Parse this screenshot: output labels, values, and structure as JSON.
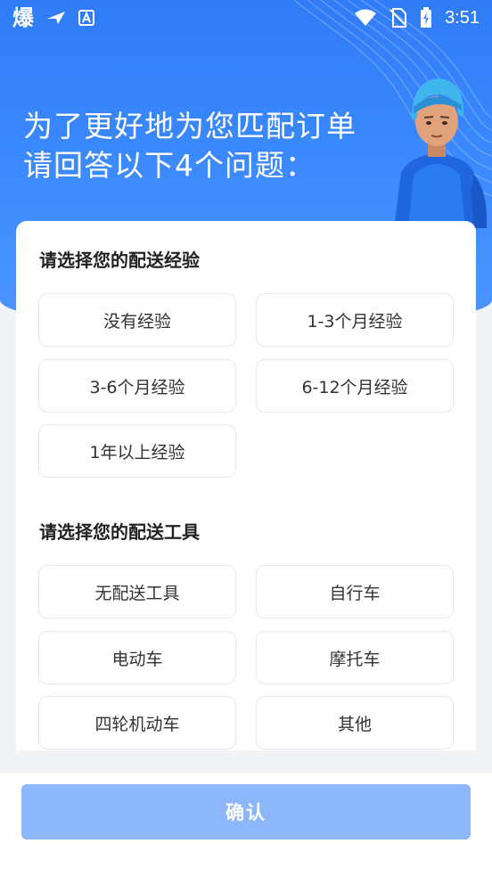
{
  "status_bar": {
    "app_icon_text": "爆",
    "time": "3:51",
    "icons": [
      "app-bao-icon",
      "send-arrow-icon",
      "accessibility-a-icon",
      "wifi-icon",
      "no-sim-icon",
      "battery-charging-icon"
    ]
  },
  "header": {
    "line1": "为了更好地为您匹配订单",
    "line2": "请回答以下4个问题："
  },
  "sections": {
    "experience": {
      "title": "请选择您的配送经验",
      "options": [
        "没有经验",
        "1-3个月经验",
        "3-6个月经验",
        "6-12个月经验",
        "1年以上经验"
      ]
    },
    "tool": {
      "title": "请选择您的配送工具",
      "options": [
        "无配送工具",
        "自行车",
        "电动车",
        "摩托车",
        "四轮机动车",
        "其他"
      ]
    }
  },
  "footer": {
    "confirm_label": "确认"
  },
  "colors": {
    "hero_blue": "#3d8bff",
    "confirm_disabled": "#8cb7fb",
    "option_border": "#e7e8eb",
    "page_bg": "#f2f3f5"
  }
}
